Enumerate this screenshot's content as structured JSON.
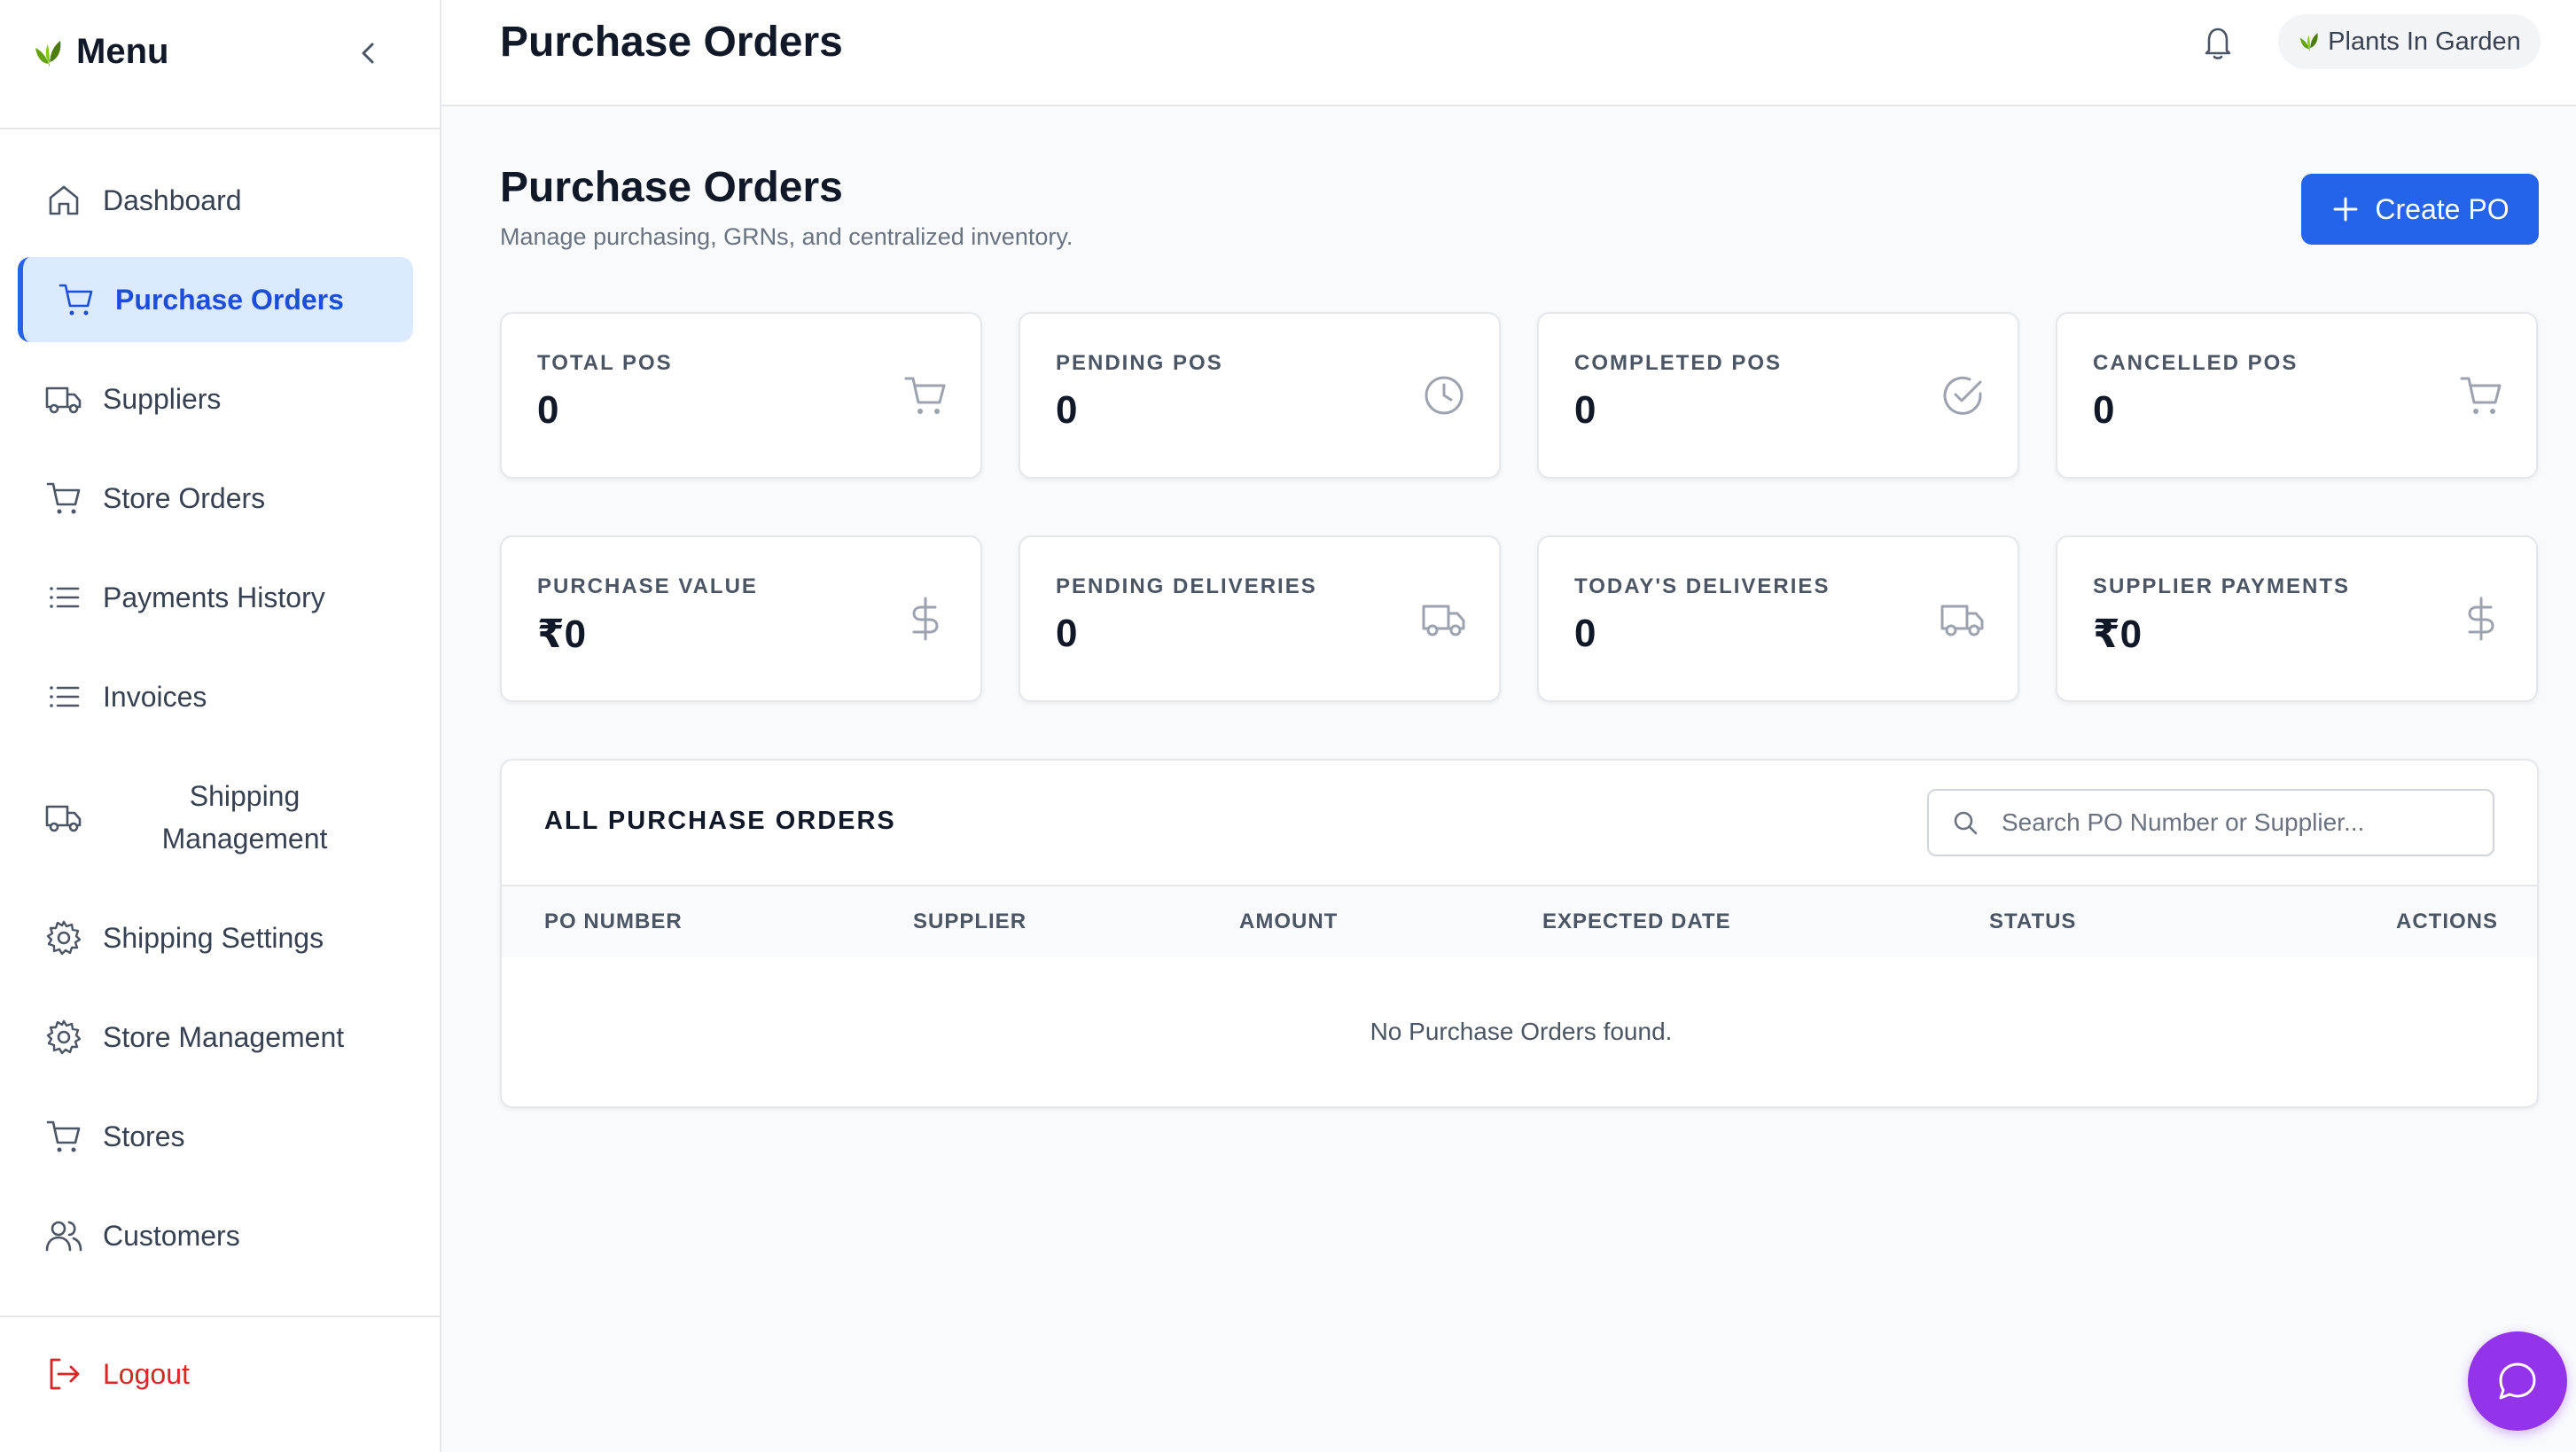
{
  "sidebar": {
    "title": "Menu",
    "items": [
      {
        "label": "Dashboard",
        "icon": "home-icon"
      },
      {
        "label": "Purchase Orders",
        "icon": "cart-icon"
      },
      {
        "label": "Suppliers",
        "icon": "truck-icon"
      },
      {
        "label": "Store Orders",
        "icon": "cart-icon"
      },
      {
        "label": "Payments History",
        "icon": "list-icon"
      },
      {
        "label": "Invoices",
        "icon": "list-icon"
      },
      {
        "label": "Shipping\nManagement",
        "icon": "truck-icon"
      },
      {
        "label": "Shipping Settings",
        "icon": "gear-icon"
      },
      {
        "label": "Store Management",
        "icon": "gear-icon"
      },
      {
        "label": "Stores",
        "icon": "cart-icon"
      },
      {
        "label": "Customers",
        "icon": "users-icon"
      }
    ],
    "active_item": "Purchase Orders",
    "logout_label": "Logout"
  },
  "topbar": {
    "title": "Purchase Orders",
    "store_name": "Plants In Garden"
  },
  "main": {
    "heading": "Purchase Orders",
    "subtitle": "Manage purchasing, GRNs, and centralized inventory.",
    "create_button_label": "Create PO",
    "stats": [
      {
        "label": "TOTAL POS",
        "value": "0",
        "icon": "cart-icon"
      },
      {
        "label": "PENDING POS",
        "value": "0",
        "icon": "clock-icon"
      },
      {
        "label": "COMPLETED POS",
        "value": "0",
        "icon": "check-circle-icon"
      },
      {
        "label": "CANCELLED POS",
        "value": "0",
        "icon": "cart-icon"
      },
      {
        "label": "PURCHASE VALUE",
        "value": "₹0",
        "icon": "dollar-icon"
      },
      {
        "label": "PENDING DELIVERIES",
        "value": "0",
        "icon": "truck-icon"
      },
      {
        "label": "TODAY'S DELIVERIES",
        "value": "0",
        "icon": "truck-icon"
      },
      {
        "label": "SUPPLIER PAYMENTS",
        "value": "₹0",
        "icon": "dollar-icon"
      }
    ],
    "table": {
      "title": "ALL PURCHASE ORDERS",
      "search_placeholder": "Search PO Number or Supplier...",
      "search_value": "",
      "columns": [
        "PO NUMBER",
        "SUPPLIER",
        "AMOUNT",
        "EXPECTED DATE",
        "STATUS",
        "ACTIONS"
      ],
      "rows": [],
      "empty_message": "No Purchase Orders found."
    }
  },
  "colors": {
    "accent": "#2563eb",
    "active_bg": "#dbeafe",
    "logout": "#dc2626",
    "chat_fab": "#9333ea"
  }
}
